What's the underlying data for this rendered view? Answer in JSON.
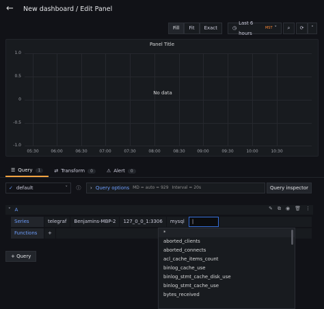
{
  "header": {
    "title": "New dashboard / Edit Panel",
    "back_icon": "arrow-left-icon"
  },
  "toolbar": {
    "fill_label": "Fill",
    "fit_label": "Fit",
    "exact_label": "Exact",
    "time_range": "Last 6 hours",
    "timezone": "MST",
    "clock_icon": "clock-icon",
    "zoom_icon": "zoom-out-icon",
    "refresh_icon": "refresh-icon",
    "refresh_dropdown_icon": "chevron-down-icon"
  },
  "panel": {
    "title": "Panel Title",
    "no_data": "No data",
    "y_ticks": [
      "1.0",
      "0.5",
      "0",
      "-0.5",
      "-1.0"
    ],
    "x_ticks": [
      "05:30",
      "06:00",
      "06:30",
      "07:00",
      "07:30",
      "08:00",
      "08:30",
      "09:00",
      "09:30",
      "10:00",
      "10:30"
    ]
  },
  "tabs": [
    {
      "label": "Query",
      "count": "1",
      "icon": "database-icon",
      "active": true
    },
    {
      "label": "Transform",
      "count": "0",
      "icon": "transform-icon",
      "active": false
    },
    {
      "label": "Alert",
      "count": "0",
      "icon": "bell-icon",
      "active": false
    }
  ],
  "datasource": {
    "name": "default",
    "info_icon": "info-icon",
    "options_label": "Query options",
    "options_md": "MD = auto = 929",
    "options_interval": "Interval = 20s",
    "inspector_label": "Query inspector"
  },
  "query": {
    "name": "A",
    "series_label": "Series",
    "series_parts": [
      "telegraf",
      "Benjamins-MBP-2",
      "127_0_0_1:3306",
      "mysql"
    ],
    "functions_label": "Functions",
    "functions_add": "+",
    "add_query_label": "+ Query"
  },
  "dropdown": {
    "items": [
      "*",
      "aborted_clients",
      "aborted_connects",
      "acl_cache_items_count",
      "binlog_cache_use",
      "binlog_stmt_cache_disk_use",
      "binlog_stmt_cache_use",
      "bytes_received"
    ]
  }
}
